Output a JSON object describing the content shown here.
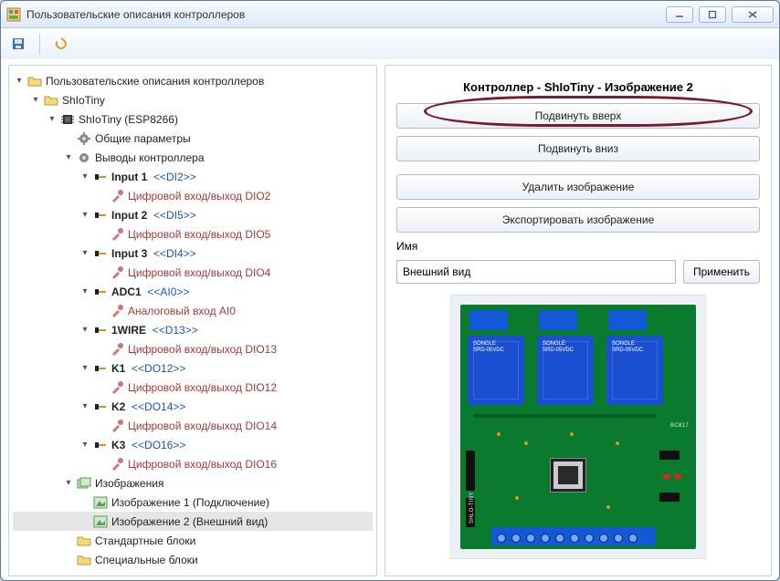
{
  "window": {
    "title": "Пользовательские описания контроллеров"
  },
  "toolbar": {},
  "tree": {
    "root": "Пользовательские описания контроллеров",
    "shlotiny": "ShIoTiny",
    "device": "ShIoTiny (ESP8266)",
    "common_params": "Общие параметры",
    "pins": "Выводы контроллера",
    "inputs": [
      {
        "name": "Input 1",
        "tag": "<<DI2>>",
        "sub": "Цифровой вход/выход DIO2"
      },
      {
        "name": "Input 2",
        "tag": "<<DI5>>",
        "sub": "Цифровой вход/выход DIO5"
      },
      {
        "name": "Input 3",
        "tag": "<<DI4>>",
        "sub": "Цифровой вход/выход DIO4"
      }
    ],
    "adc": {
      "name": "ADC1",
      "tag": "<<AI0>>",
      "sub": "Аналоговый вход AI0"
    },
    "onewire": {
      "name": "1WIRE",
      "tag": "<<D13>>",
      "sub": "Цифровой вход/выход DIO13"
    },
    "k": [
      {
        "name": "K1",
        "tag": "<<DO12>>",
        "sub": "Цифровой вход/выход DIO12"
      },
      {
        "name": "K2",
        "tag": "<<DO14>>",
        "sub": "Цифровой вход/выход DIO14"
      },
      {
        "name": "K3",
        "tag": "<<DO16>>",
        "sub": "Цифровой вход/выход DIO16"
      }
    ],
    "images_node": "Изображения",
    "image1": "Изображение 1 (Подключение)",
    "image2": "Изображение 2 (Внешний вид)",
    "std_blocks": "Стандартные блоки",
    "spec_blocks": "Специальные блоки"
  },
  "right": {
    "title": "Контроллер - ShIoTiny - Изображение 2",
    "btn_up": "Подвинуть вверх",
    "btn_down": "Подвинуть вниз",
    "btn_delete": "Удалить изображение",
    "btn_export": "Экспортировать изображение",
    "name_label": "Имя",
    "name_value": "Внешний вид",
    "apply": "Применить"
  }
}
